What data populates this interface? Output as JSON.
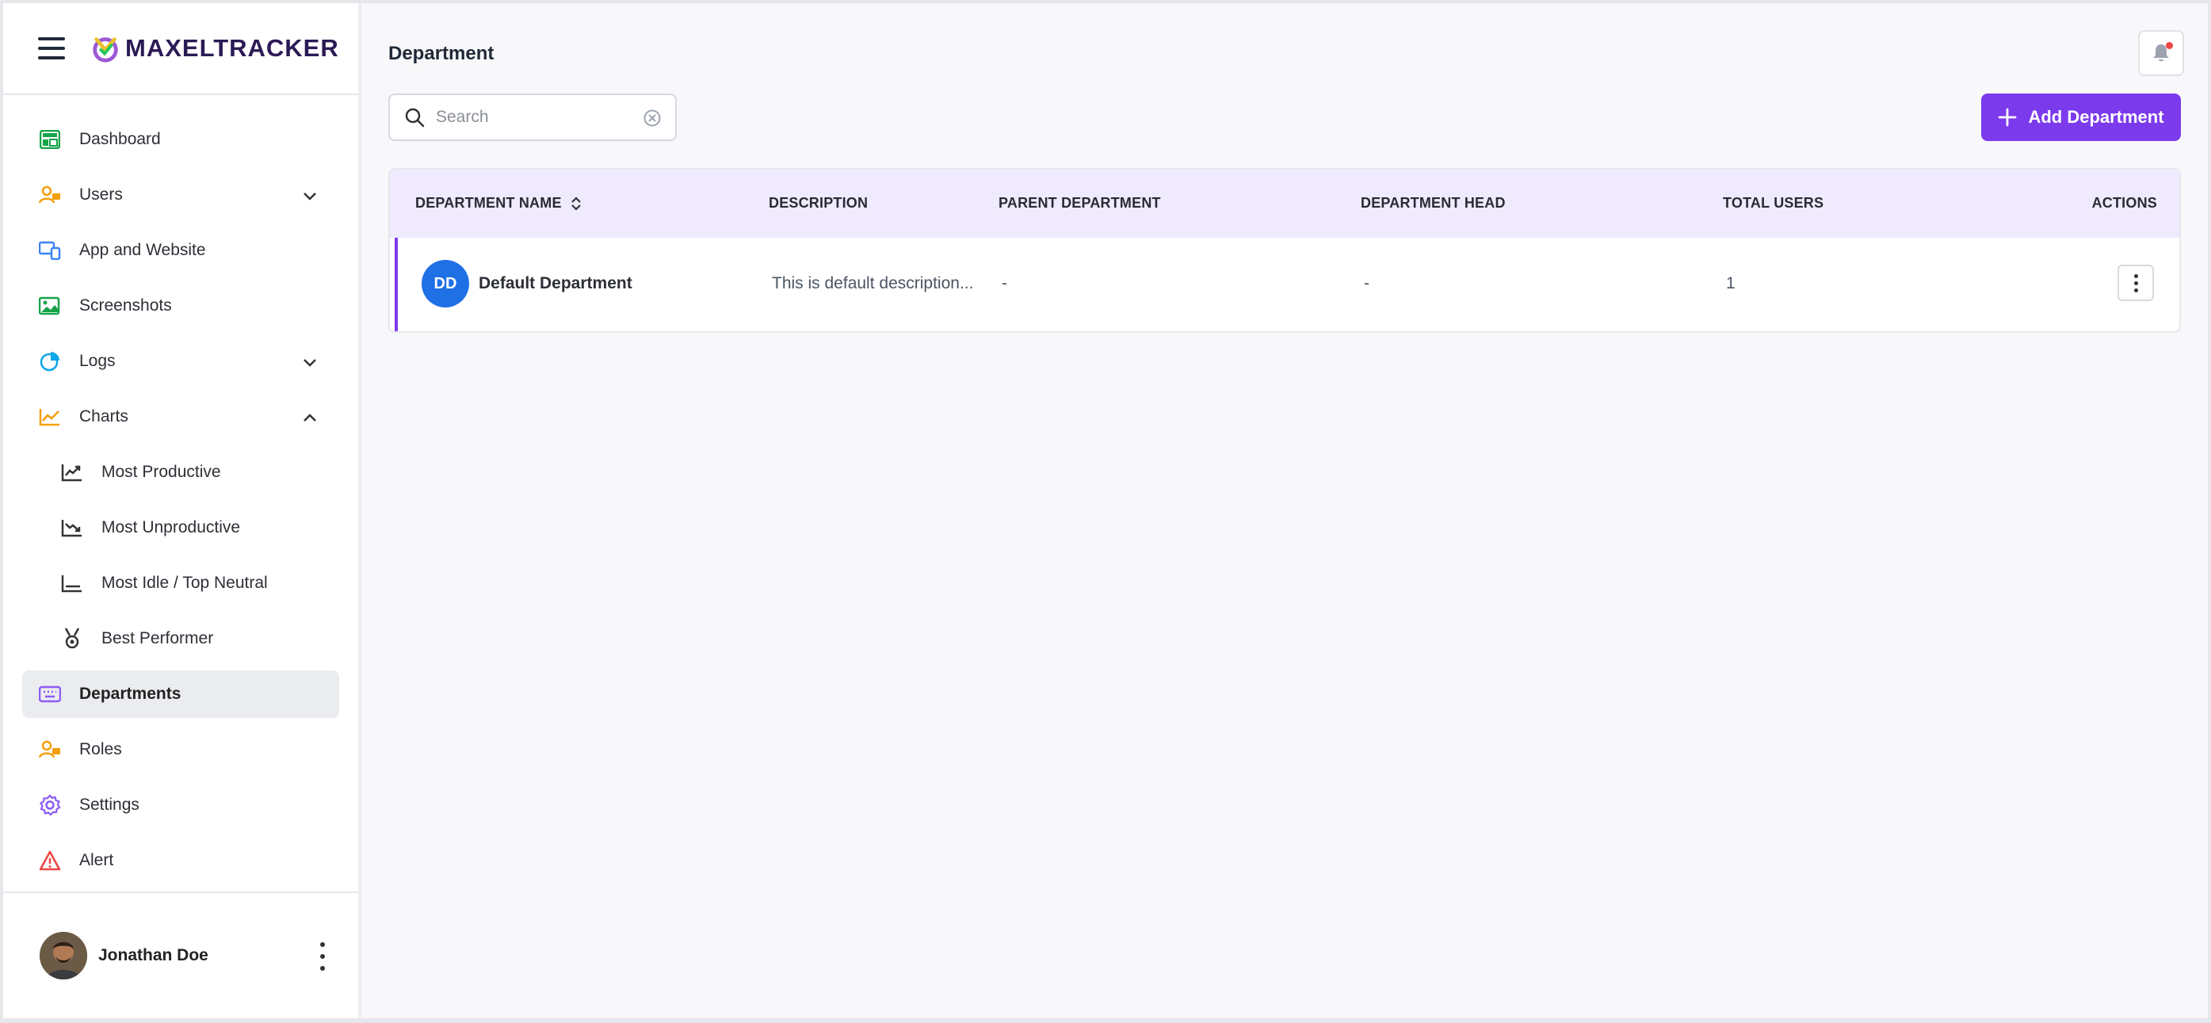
{
  "brand": {
    "name": "MAXELTRACKER"
  },
  "sidebar": {
    "items": [
      {
        "label": "Dashboard"
      },
      {
        "label": "Users"
      },
      {
        "label": "App and Website"
      },
      {
        "label": "Screenshots"
      },
      {
        "label": "Logs"
      },
      {
        "label": "Charts"
      },
      {
        "label": "Most Productive"
      },
      {
        "label": "Most Unproductive"
      },
      {
        "label": "Most Idle / Top Neutral"
      },
      {
        "label": "Best Performer"
      },
      {
        "label": "Departments"
      },
      {
        "label": "Roles"
      },
      {
        "label": "Settings"
      },
      {
        "label": "Alert"
      }
    ],
    "user": {
      "name": "Jonathan Doe"
    }
  },
  "header": {
    "title": "Department"
  },
  "search": {
    "placeholder": "Search",
    "value": ""
  },
  "actions": {
    "add_label": "Add Department"
  },
  "table": {
    "columns": [
      "DEPARTMENT NAME",
      "DESCRIPTION",
      "PARENT DEPARTMENT",
      "DEPARTMENT HEAD",
      "TOTAL USERS",
      "ACTIONS"
    ],
    "rows": [
      {
        "initials": "DD",
        "name": "Default Department",
        "description": "This is default description...",
        "parent": "-",
        "head": "-",
        "total_users": "1"
      }
    ]
  },
  "colors": {
    "accent": "#7c3aed",
    "badge": "#1f6fe5",
    "header_bg": "#efeafd",
    "notification_dot": "#ef4444"
  }
}
